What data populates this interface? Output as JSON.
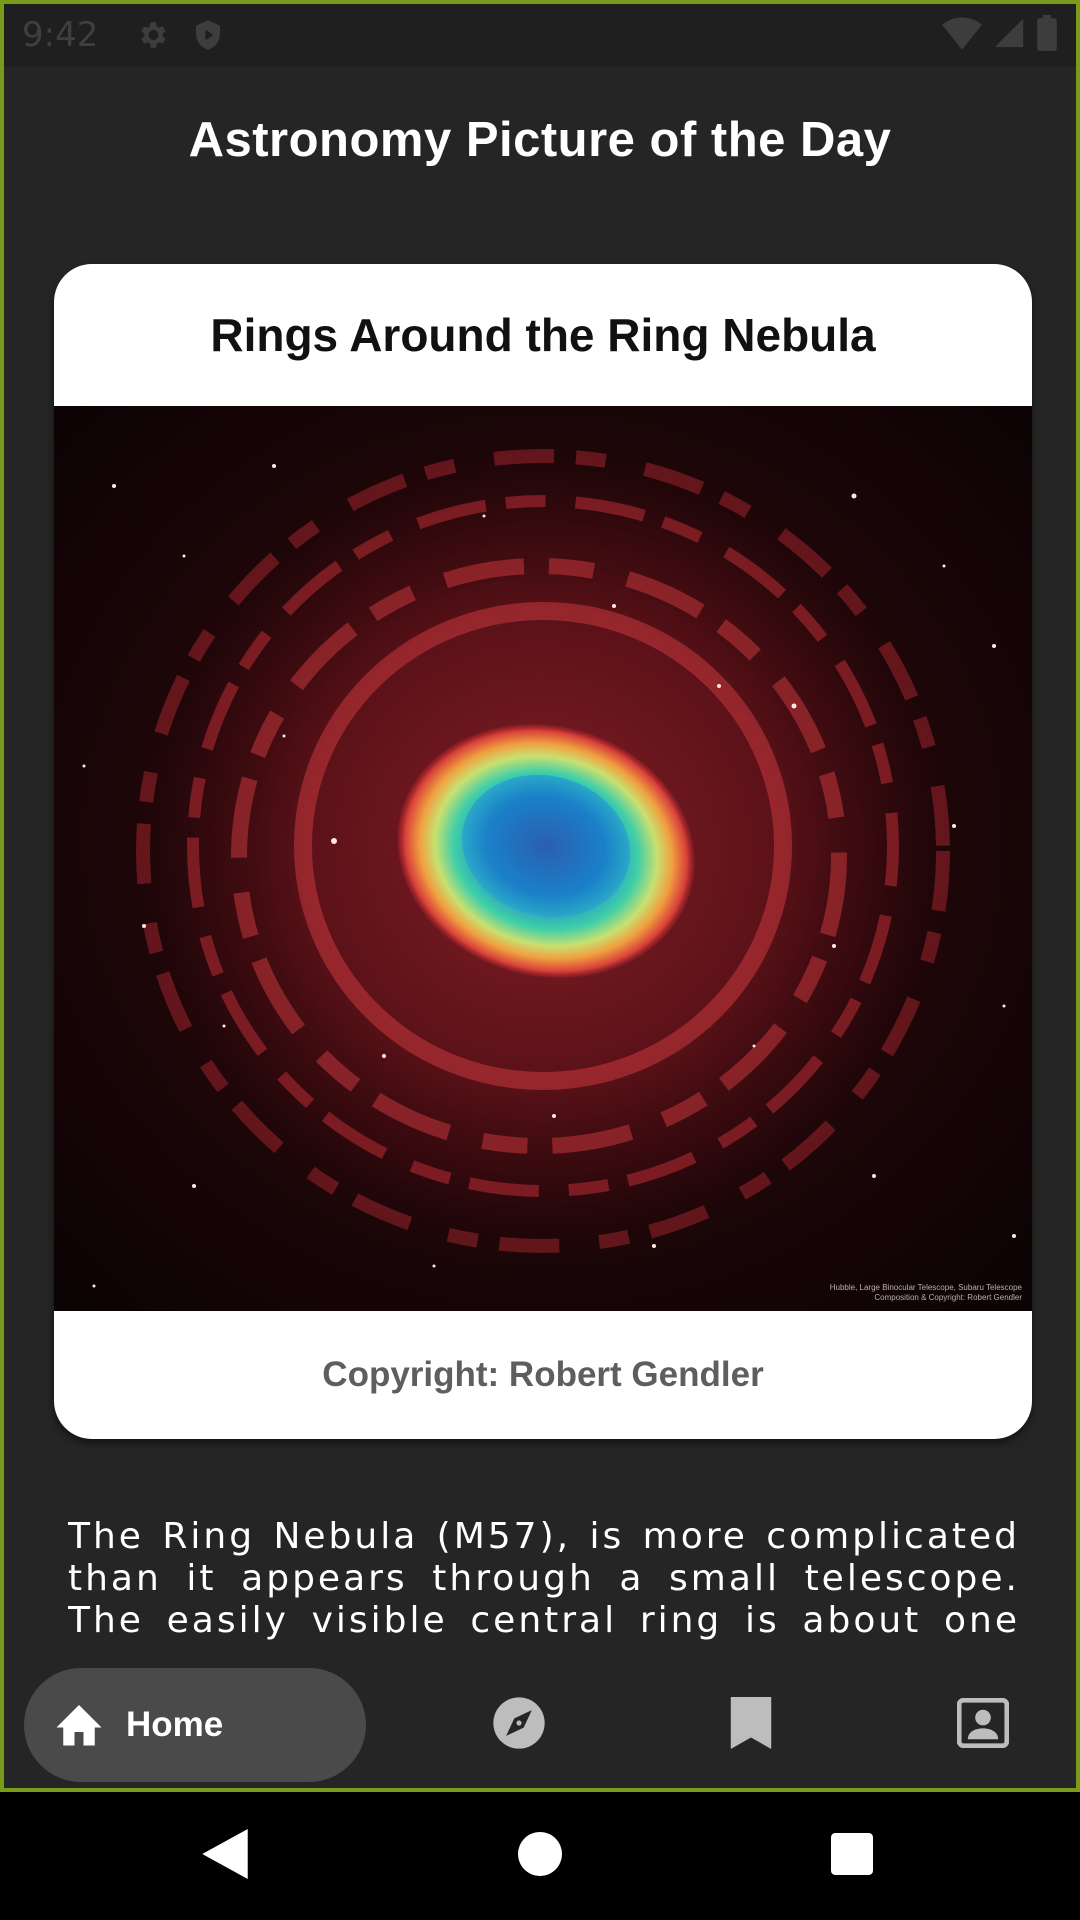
{
  "status_bar": {
    "time": "9:42",
    "icons_left": [
      "gear-icon",
      "shield-play-icon"
    ],
    "icons_right": [
      "wifi-icon",
      "signal-icon",
      "battery-icon"
    ]
  },
  "header": {
    "title": "Astronomy Picture of the Day"
  },
  "card": {
    "title": "Rings Around the Ring Nebula",
    "image_credit_line1": "Hubble, Large Binocular Telescope, Subaru Telescope",
    "image_credit_line2": "Composition & Copyright: Robert Gendler",
    "copyright": "Copyright: Robert Gendler"
  },
  "explanation": {
    "text": "The Ring Nebula (M57), is more complicated than it appears through a small telescope.  The easily visible central ring is about one light-year across,"
  },
  "bottom_nav": {
    "items": [
      {
        "label": "Home",
        "icon": "home-icon",
        "selected": true
      },
      {
        "label": "",
        "icon": "compass-icon",
        "selected": false
      },
      {
        "label": "",
        "icon": "bookmark-icon",
        "selected": false
      },
      {
        "label": "",
        "icon": "account-box-icon",
        "selected": false
      }
    ]
  },
  "system_nav": {
    "buttons": [
      "back-icon",
      "home-circle-icon",
      "recents-icon"
    ]
  },
  "colors": {
    "background": "#252525",
    "card": "#ffffff",
    "nav_selected": "#4a4a4a",
    "frame_border": "#7a9a1a"
  }
}
